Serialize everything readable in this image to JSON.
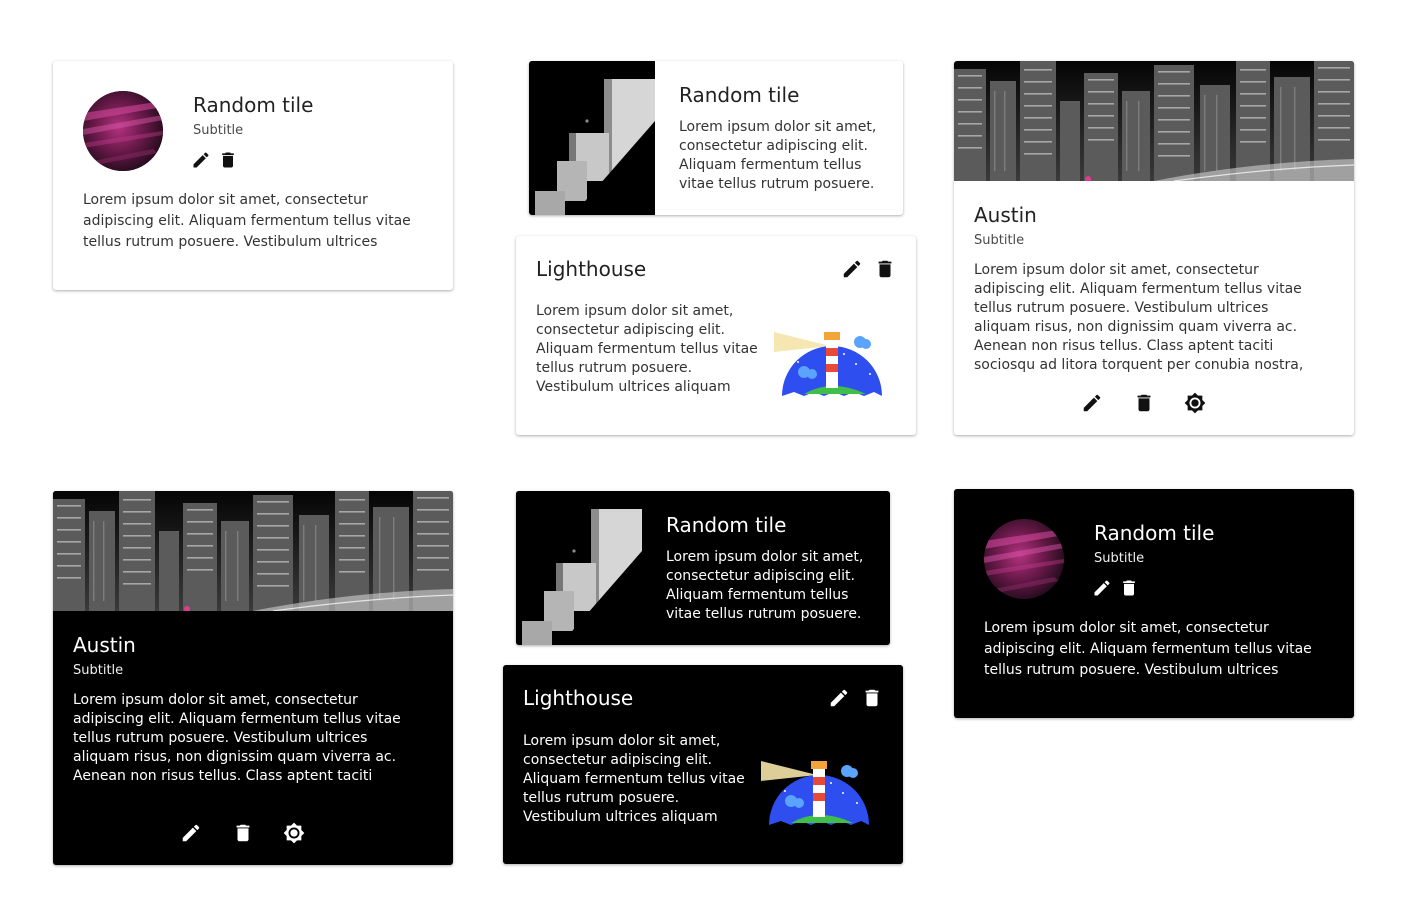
{
  "cards": {
    "c1": {
      "title": "Random tile",
      "subtitle": "Subtitle",
      "body": "Lorem ipsum dolor sit amet, consectetur adipiscing elit. Aliquam fermentum tellus vitae tellus rutrum posuere. Vestibulum ultrices aliquam risus, non",
      "actions": [
        "edit-icon",
        "delete-icon"
      ]
    },
    "c2": {
      "title": "Random tile",
      "body": "Lorem ipsum dolor sit amet, consectetur adipiscing elit. Aliquam fermentum tellus vitae tellus rutrum posuere."
    },
    "c3": {
      "title": "Lighthouse",
      "body": "Lorem ipsum dolor sit amet, consectetur adipiscing elit. Aliquam fermentum tellus vitae tellus rutrum posuere. Vestibulum ultrices aliquam risus,",
      "actions": [
        "edit-icon",
        "delete-icon"
      ]
    },
    "c4": {
      "title": "Austin",
      "subtitle": "Subtitle",
      "body": "Lorem ipsum dolor sit amet, consectetur adipiscing elit. Aliquam fermentum tellus vitae tellus rutrum posuere. Vestibulum ultrices aliquam risus, non dignissim quam viverra ac. Aenean non risus tellus. Class aptent taciti sociosqu ad litora torquent per conubia nostra, per inceptos himenaeos. Proin",
      "actions": [
        "edit-icon",
        "delete-icon",
        "brightness-icon"
      ]
    },
    "c5": {
      "title": "Austin",
      "subtitle": "Subtitle",
      "body": "Lorem ipsum dolor sit amet, consectetur adipiscing elit. Aliquam fermentum tellus vitae tellus rutrum posuere. Vestibulum ultrices aliquam risus, non dignissim quam viverra ac. Aenean non risus tellus. Class aptent taciti sociosqu ad litora torquent per",
      "actions": [
        "edit-icon",
        "delete-icon",
        "brightness-icon"
      ]
    },
    "c6": {
      "title": "Random tile",
      "body": "Lorem ipsum dolor sit amet, consectetur adipiscing elit. Aliquam fermentum tellus vitae tellus rutrum posuere."
    },
    "c7": {
      "title": "Lighthouse",
      "body": "Lorem ipsum dolor sit amet, consectetur adipiscing elit. Aliquam fermentum tellus vitae tellus rutrum posuere. Vestibulum ultrices aliquam risus,",
      "actions": [
        "edit-icon",
        "delete-icon"
      ]
    },
    "c8": {
      "title": "Random tile",
      "subtitle": "Subtitle",
      "body": "Lorem ipsum dolor sit amet, consectetur adipiscing elit. Aliquam fermentum tellus vitae tellus rutrum posuere. Vestibulum ultrices aliquam risus, non",
      "actions": [
        "edit-icon",
        "delete-icon"
      ]
    }
  },
  "colors": {
    "light_card": "#ffffff",
    "dark_card": "#000000",
    "lighthouse_sky": "#2f4ef0",
    "lighthouse_hill": "#3fbf4a"
  }
}
